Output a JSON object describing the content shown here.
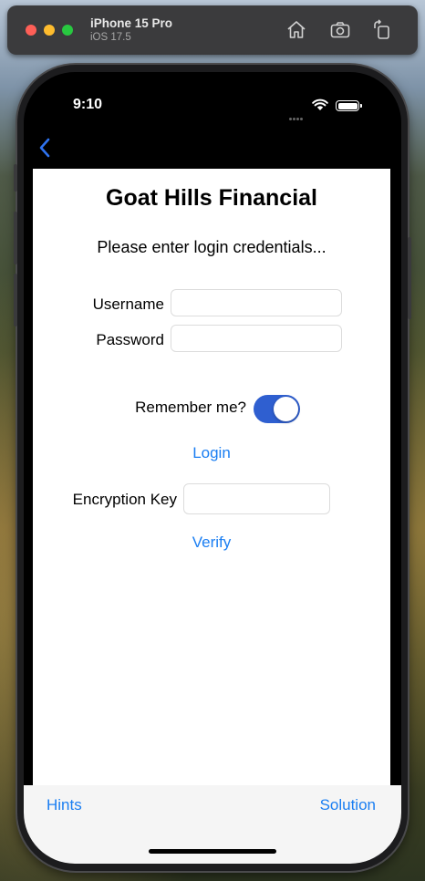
{
  "simulator": {
    "device_name": "iPhone 15 Pro",
    "os_version": "iOS 17.5",
    "icons": [
      "home-icon",
      "screenshot-icon",
      "rotate-icon"
    ]
  },
  "status_bar": {
    "time": "9:10",
    "icons": [
      "wifi-icon",
      "battery-icon"
    ]
  },
  "nav": {
    "back_icon": "chevron-left-icon"
  },
  "app": {
    "title": "Goat Hills Financial",
    "subtitle": "Please enter login credentials...",
    "username_label": "Username",
    "username_value": "",
    "password_label": "Password",
    "password_value": "",
    "remember_label": "Remember me?",
    "remember_on": true,
    "login_label": "Login",
    "encryption_label": "Encryption Key",
    "encryption_value": "",
    "verify_label": "Verify"
  },
  "toolbar": {
    "hints_label": "Hints",
    "solution_label": "Solution"
  },
  "colors": {
    "accent": "#1a7ef2",
    "toggle_on": "#2f5fd0"
  }
}
